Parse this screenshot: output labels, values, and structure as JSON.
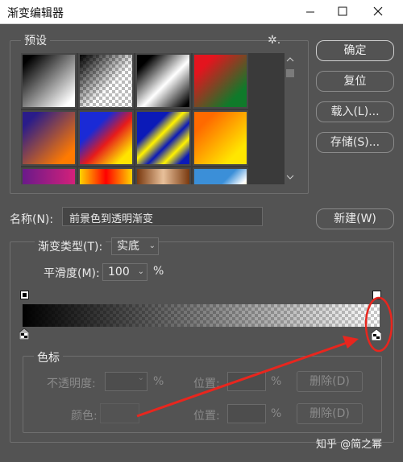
{
  "window": {
    "title": "渐变编辑器",
    "min_icon": "minimize-icon",
    "max_icon": "maximize-icon",
    "close_icon": "close-icon"
  },
  "presets": {
    "legend": "预设",
    "gear_icon": "gear-icon",
    "gear_glyph": "✲."
  },
  "buttons": {
    "ok": "确定",
    "reset": "复位",
    "load": "载入(L)...",
    "save": "存储(S)...",
    "new": "新建(W)"
  },
  "name": {
    "label": "名称(N):",
    "value": "前景色到透明渐变"
  },
  "gradient_type": {
    "legend_label": "渐变类型(T):",
    "value": "实底",
    "smoothness_label": "平滑度(M):",
    "smoothness_value": "100",
    "smoothness_unit": "%"
  },
  "color_stops": {
    "legend": "色标",
    "opacity_label": "不透明度:",
    "opacity_unit": "%",
    "location_label": "位置:",
    "location_unit": "%",
    "delete_label": "删除(D)",
    "color_label": "颜色:"
  },
  "watermark": "知乎 @简之幂",
  "colors": {
    "dialog_bg": "#535353",
    "title_bg": "#ffffff",
    "annotation": "#e8261e"
  }
}
